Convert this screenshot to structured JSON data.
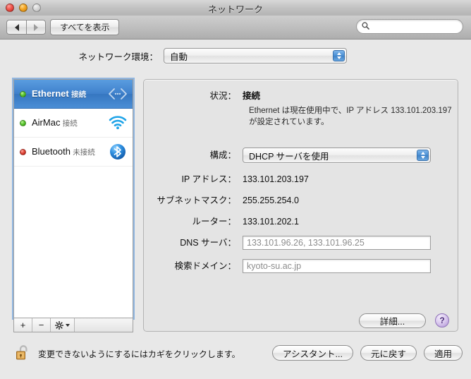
{
  "window": {
    "title": "ネットワーク",
    "traffic_lights": [
      "close-button",
      "minimize-button",
      "zoom-button"
    ]
  },
  "toolbar": {
    "back_icon": "back-arrow-icon",
    "forward_icon": "forward-arrow-icon",
    "show_all_label": "すべてを表示",
    "search": {
      "icon": "search-icon",
      "value": "",
      "placeholder": ""
    }
  },
  "location": {
    "label": "ネットワーク環境：",
    "selected": "自動"
  },
  "sidebar": {
    "services": [
      {
        "name": "Ethernet",
        "status": "接続",
        "state": "green",
        "icon": "ethernet-icon",
        "selected": true
      },
      {
        "name": "AirMac",
        "status": "接続",
        "state": "green",
        "icon": "wifi-icon",
        "selected": false
      },
      {
        "name": "Bluetooth",
        "status": "未接続",
        "state": "red",
        "icon": "bluetooth-icon",
        "selected": false
      }
    ],
    "toolbar": {
      "add_label": "+",
      "remove_label": "−",
      "action_label": "⚙"
    }
  },
  "detail": {
    "status_label": "状況：",
    "status_value": "接続",
    "status_description": "Ethernet は現在使用中で、IP アドレス 133.101.203.197 が設定されています。",
    "configure_label": "構成：",
    "configure_value": "DHCP サーバを使用",
    "ip_label": "IP アドレス：",
    "ip_value": "133.101.203.197",
    "subnet_label": "サブネットマスク：",
    "subnet_value": "255.255.254.0",
    "router_label": "ルーター：",
    "router_value": "133.101.202.1",
    "dns_label": "DNS サーバ：",
    "dns_value": "133.101.96.26, 133.101.96.25",
    "domain_label": "検索ドメイン：",
    "domain_value": "kyoto-su.ac.jp",
    "advanced_label": "詳細...",
    "help_label": "?"
  },
  "bottom": {
    "lock_icon": "unlocked-padlock-icon",
    "lock_text": "変更できないようにするにはカギをクリックします。",
    "assistant_label": "アシスタント...",
    "revert_label": "元に戻す",
    "apply_label": "適用"
  },
  "colors": {
    "selection_blue": "#3f80cb",
    "connected_green": "#5ec832",
    "disconnected_red": "#e0483a",
    "help_purple": "#ae92d4",
    "window_bg": "#e8e8e8"
  }
}
